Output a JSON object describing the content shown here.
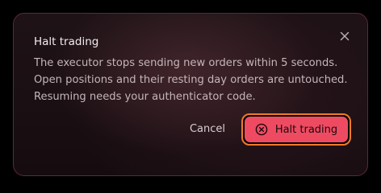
{
  "dialog": {
    "title": "Halt trading",
    "body_lines": [
      "The executor stops sending new orders within 5 seconds.",
      "Open positions and their resting day orders are untouched.",
      "Resuming needs your authenticator code."
    ],
    "close_icon": "close-icon",
    "cancel_label": "Cancel",
    "confirm_label": "Halt trading",
    "confirm_icon": "x-circle-icon"
  },
  "colors": {
    "confirm_fill": "#ee4b62",
    "confirm_outline": "#f07a2a",
    "dialog_background": "#1c1115",
    "dialog_border": "#5a2a36"
  }
}
